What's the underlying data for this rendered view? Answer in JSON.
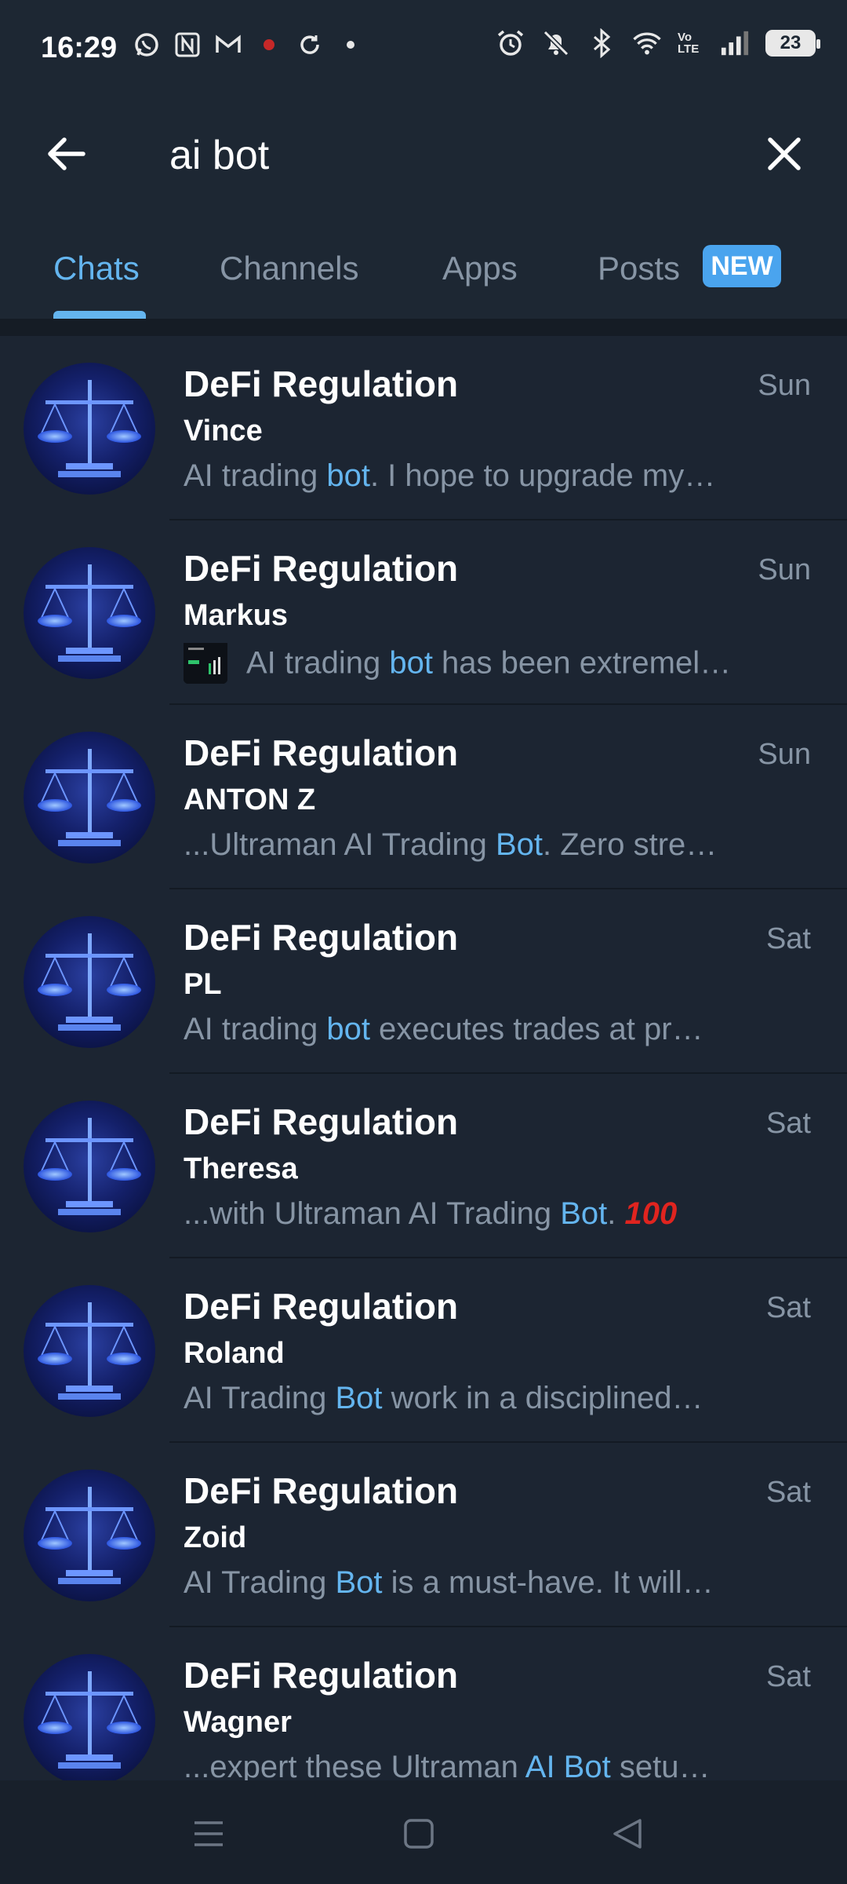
{
  "status": {
    "time": "16:29",
    "battery": "23",
    "left_icons": [
      "whatsapp-icon",
      "notion-icon",
      "gmail-icon",
      "record-icon",
      "sync-icon",
      "dot-icon"
    ],
    "right_icons": [
      "alarm-icon",
      "bell-off-icon",
      "bluetooth-icon",
      "wifi-icon",
      "volte-icon",
      "signal-icon",
      "battery-icon"
    ],
    "volte_label": "Vo LTE"
  },
  "search": {
    "value": "ai bot"
  },
  "tabs": [
    {
      "label": "Chats",
      "active": true
    },
    {
      "label": "Channels",
      "active": false
    },
    {
      "label": "Apps",
      "active": false
    },
    {
      "label": "Posts",
      "active": false
    }
  ],
  "new_badge": "NEW",
  "results": [
    {
      "title": "DeFi Regulation",
      "date": "Sun",
      "sender": "Vince",
      "pre": " AI trading ",
      "hl": "bot",
      "post": ". I hope to upgrade my…",
      "thumb": false,
      "emoji": ""
    },
    {
      "title": "DeFi Regulation",
      "date": "Sun",
      "sender": "Markus",
      "pre": "AI trading ",
      "hl": "bot",
      "post": " has been extremel…",
      "thumb": true,
      "emoji": ""
    },
    {
      "title": "DeFi Regulation",
      "date": "Sun",
      "sender": "ANTON Z",
      "pre": "...Ultraman AI Trading ",
      "hl": "Bot",
      "post": ". Zero stre…",
      "thumb": false,
      "emoji": ""
    },
    {
      "title": "DeFi Regulation",
      "date": "Sat",
      "sender": "PL",
      "pre": " AI trading ",
      "hl": "bot",
      "post": " executes trades at pr…",
      "thumb": false,
      "emoji": ""
    },
    {
      "title": "DeFi Regulation",
      "date": "Sat",
      "sender": "Theresa",
      "pre": "...with Ultraman AI Trading ",
      "hl": "Bot",
      "post": ". ",
      "thumb": false,
      "emoji": "100"
    },
    {
      "title": "DeFi Regulation",
      "date": "Sat",
      "sender": "Roland",
      "pre": " AI Trading ",
      "hl": "Bot",
      "post": " work in a disciplined…",
      "thumb": false,
      "emoji": ""
    },
    {
      "title": "DeFi Regulation",
      "date": "Sat",
      "sender": "Zoid",
      "pre": " AI Trading ",
      "hl": "Bot",
      "post": " is a must-have. It will…",
      "thumb": false,
      "emoji": ""
    },
    {
      "title": "DeFi Regulation",
      "date": "Sat",
      "sender": "Wagner",
      "pre": "...expert these Ultraman ",
      "hl": "AI Bot",
      "post": " setu…",
      "thumb": false,
      "emoji": ""
    }
  ],
  "colors": {
    "background": "#1c2532",
    "accent": "#64b5ef",
    "muted": "#8795a5",
    "badge": "#4aa4ee"
  },
  "navbar": [
    "menu-icon",
    "home-icon",
    "back-triangle-icon"
  ]
}
